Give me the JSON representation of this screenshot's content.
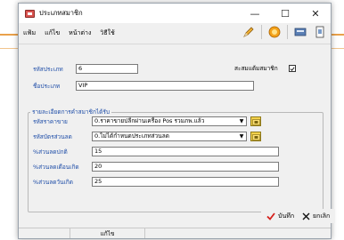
{
  "window": {
    "title": "ประเภทสมาชิก",
    "controls": {
      "minimize": "—",
      "maximize": "☐",
      "close": "✕"
    }
  },
  "menu": {
    "items": [
      "แฟ้ม",
      "แก้ไข",
      "หน้าต่าง",
      "วิธีใช้"
    ]
  },
  "toolbar": {
    "icons": [
      "pencil-icon",
      "help-icon",
      "keyboard-icon",
      "document-icon"
    ]
  },
  "form": {
    "code_label": "รหัสประเภท",
    "code_value": "6",
    "accumulate_label": "สะสมแต้มสมาชิก",
    "accumulate_checked": true,
    "name_label": "ชื่อประเภท",
    "name_value": "VIP"
  },
  "details": {
    "legend": "รายละเอียดการคำสมาชิกได้รับ",
    "price_label": "รหัสราคาขาย",
    "price_value": "0.ราคาขายปลีกผ่านเครื่อง Pos รวมภพ.แล้ว",
    "discount_label": "รหัสบัตรส่วนลด",
    "discount_value": "0.ไม่ได้กำหนดประเภทส่วนลด",
    "normal_discount_label": "%ส่วนลดปกติ",
    "normal_discount_value": "15",
    "month_discount_label": "%ส่วนลดเดือนเกิด",
    "month_discount_value": "20",
    "day_discount_label": "%ส่วนลดวันเกิด",
    "day_discount_value": "25"
  },
  "actions": {
    "save_label": "บันทึก",
    "cancel_label": "ยกเลิก"
  },
  "status": {
    "mode": "แก้ไข"
  }
}
